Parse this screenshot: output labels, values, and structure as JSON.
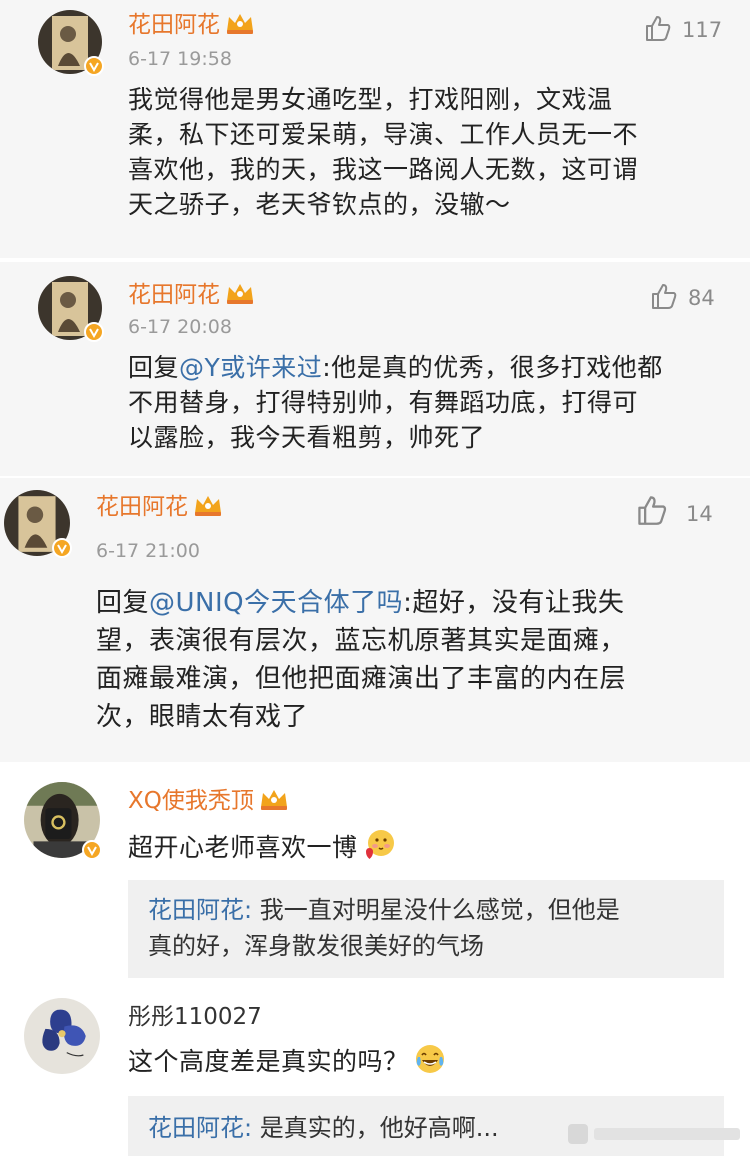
{
  "comments": [
    {
      "name": "花田阿花",
      "time": "6-17 19:58",
      "likes": "117",
      "lines": [
        "我觉得他是男女通吃型，打戏阳刚，文戏温",
        "柔，私下还可爱呆萌，导演、工作人员无一不",
        "喜欢他，我的天，我这一路阅人无数，这可谓",
        "天之骄子，老天爷钦点的，没辙～"
      ]
    },
    {
      "name": "花田阿花",
      "time": "6-17 20:08",
      "likes": "84",
      "reply_prefix": "回复",
      "mention": "@Y或许来过",
      "lines": [
        ":他是真的优秀，很多打戏他都",
        "不用替身，打得特别帅，有舞蹈功底，打得可",
        "以露脸，我今天看粗剪，帅死了"
      ]
    },
    {
      "name": "花田阿花",
      "time": "6-17 21:00",
      "likes": "14",
      "reply_prefix": "回复",
      "mention": "@UNIQ今天合体了吗",
      "lines": [
        ":超好，没有让我失",
        "望，表演很有层次，蓝忘机原著其实是面瘫，",
        "面瘫最难演，但他把面瘫演出了丰富的内在层",
        "次，眼睛太有戏了"
      ]
    },
    {
      "name": "XQ使我秃顶",
      "text": "超开心老师喜欢一博",
      "emoji": "blush-heart-emoji",
      "reply": {
        "name": "花田阿花",
        "sep": ":",
        "lines": [
          " 我一直对明星没什么感觉，但他是",
          "真的好，浑身散发很美好的气场"
        ]
      }
    },
    {
      "name": "彤彤110027",
      "text": "这个高度差是真实的吗？",
      "emoji": "tears-of-joy-emoji",
      "reply": {
        "name": "花田阿花",
        "sep": ":",
        "lines": [
          " 是真实的，他好高啊..."
        ]
      }
    }
  ],
  "colors": {
    "name_orange": "#e7772c",
    "mention_blue": "#3a6fa8",
    "card_bg": "#f6f6f6",
    "reply_bg": "#f0f0f0"
  },
  "icons": [
    "thumbs-up-icon",
    "crown-icon",
    "verified-badge-icon"
  ]
}
